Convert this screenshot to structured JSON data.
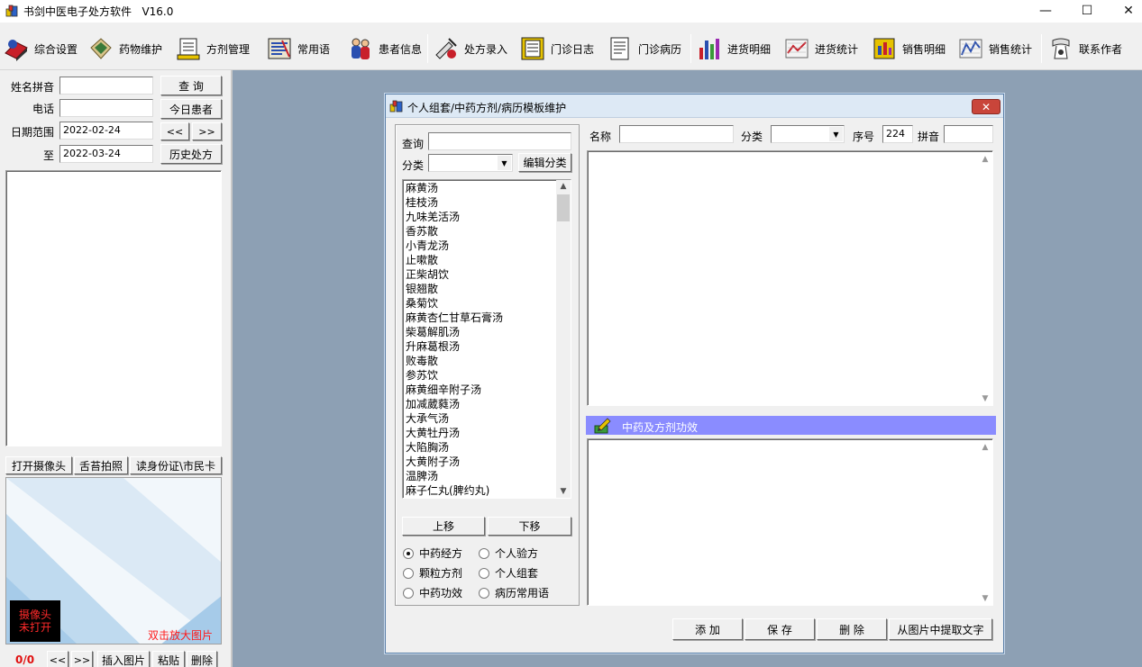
{
  "window": {
    "title": "书剑中医电子处方软件   V16.0",
    "controls": {
      "minimize": "—",
      "maximize": "☐",
      "close": "✕"
    }
  },
  "toolbar": {
    "items": [
      {
        "label": "综合设置",
        "icon": "settings-book-icon"
      },
      {
        "label": "药物维护",
        "icon": "medicine-icon"
      },
      {
        "label": "方剂管理",
        "icon": "prescription-icon"
      },
      {
        "label": "常用语",
        "icon": "phrases-icon"
      },
      {
        "label": "患者信息",
        "icon": "patients-icon"
      },
      {
        "label": "处方录入",
        "icon": "prescription-entry-icon"
      },
      {
        "label": "门诊日志",
        "icon": "clinic-log-icon"
      },
      {
        "label": "门诊病历",
        "icon": "medical-record-icon"
      },
      {
        "label": "进货明细",
        "icon": "purchase-detail-icon"
      },
      {
        "label": "进货统计",
        "icon": "purchase-stats-icon"
      },
      {
        "label": "销售明细",
        "icon": "sales-detail-icon"
      },
      {
        "label": "销售统计",
        "icon": "sales-stats-icon"
      },
      {
        "label": "联系作者",
        "icon": "contact-icon"
      }
    ]
  },
  "left": {
    "name_label": "姓名拼音",
    "name_value": "",
    "query_button": "查  询",
    "phone_label": "电话",
    "phone_value": "",
    "today_button": "今日患者",
    "date_label": "日期范围",
    "date_from": "2022-02-24",
    "prev_button": "<<",
    "next_button": ">>",
    "to_label": "至",
    "date_to": "2022-03-24",
    "history_button": "历史处方",
    "camera_button": "打开摄像头",
    "tongue_button": "舌苔拍照",
    "idcard_button": "读身份证\\市民卡",
    "camera_status_line1": "摄像头",
    "camera_status_line2": "未打开",
    "enlarge_hint": "双击放大图片",
    "photo_count": "0/0",
    "photo_prev": "<<",
    "photo_next": ">>",
    "insert_button": "插入图片",
    "paste_button": "粘贴",
    "delete_button": "删除"
  },
  "dialog": {
    "title": "个人组套/中药方剂/病历模板维护",
    "close": "✕",
    "search_label": "查询",
    "search_value": "",
    "category_label": "分类",
    "category_value": "",
    "edit_category_button": "编辑分类",
    "list": [
      "麻黄汤",
      "桂枝汤",
      "九味羌活汤",
      "香苏散",
      "小青龙汤",
      "止嗽散",
      "正柴胡饮",
      "银翘散",
      "桑菊饮",
      "麻黄杏仁甘草石膏汤",
      "柴葛解肌汤",
      "升麻葛根汤",
      "败毒散",
      "参苏饮",
      "麻黄细辛附子汤",
      "加减葳蕤汤",
      "大承气汤",
      "大黄牡丹汤",
      "大陷胸汤",
      "大黄附子汤",
      "温脾汤",
      "麻子仁丸(脾约丸)"
    ],
    "move_up_button": "上移",
    "move_down_button": "下移",
    "radios": [
      {
        "label": "中药经方",
        "checked": true
      },
      {
        "label": "个人验方",
        "checked": false
      },
      {
        "label": "颗粒方剂",
        "checked": false
      },
      {
        "label": "个人组套",
        "checked": false
      },
      {
        "label": "中药功效",
        "checked": false
      },
      {
        "label": "病历常用语",
        "checked": false
      }
    ],
    "name_label": "名称",
    "name_value": "",
    "cat2_label": "分类",
    "cat2_value": "",
    "seq_label": "序号",
    "seq_value": "224",
    "pinyin_label": "拼音",
    "pinyin_value": "",
    "section_header": "中药及方剂功效",
    "add_button": "添  加",
    "save_button": "保  存",
    "delete_button": "删  除",
    "ocr_button": "从图片中提取文字"
  }
}
